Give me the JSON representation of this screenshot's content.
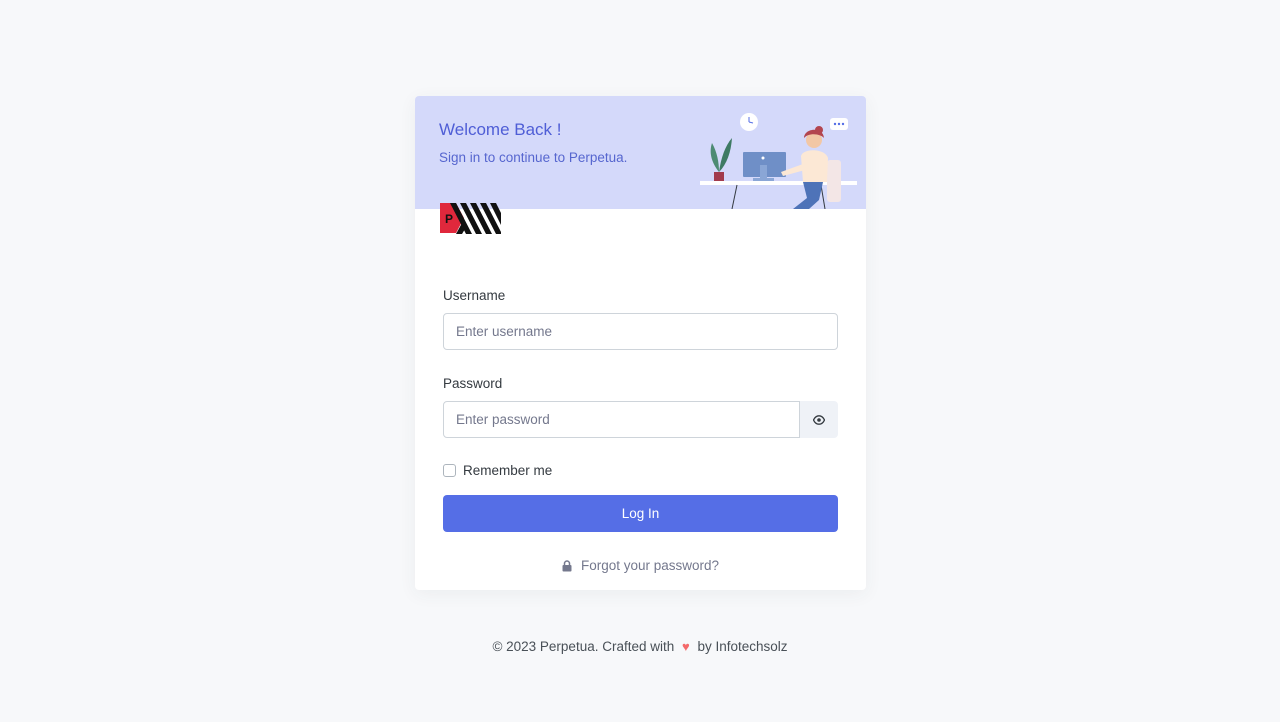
{
  "header": {
    "title": "Welcome Back !",
    "subtitle": "Sign in to continue to Perpetua."
  },
  "logo": {
    "letter": "P",
    "icon": "perpetua-logo"
  },
  "form": {
    "username_label": "Username",
    "username_placeholder": "Enter username",
    "username_value": "",
    "password_label": "Password",
    "password_placeholder": "Enter password",
    "password_value": "",
    "remember_label": "Remember me",
    "remember_checked": false,
    "login_label": "Log In",
    "forgot_label": "Forgot your password?"
  },
  "footer": {
    "prefix": "© 2023 Perpetua. Crafted with",
    "suffix": "by Infotechsolz"
  },
  "colors": {
    "primary": "#556ee6",
    "header_bg": "#d4d9fa",
    "heart": "#f46a6a",
    "logo_red": "#e0283c"
  }
}
